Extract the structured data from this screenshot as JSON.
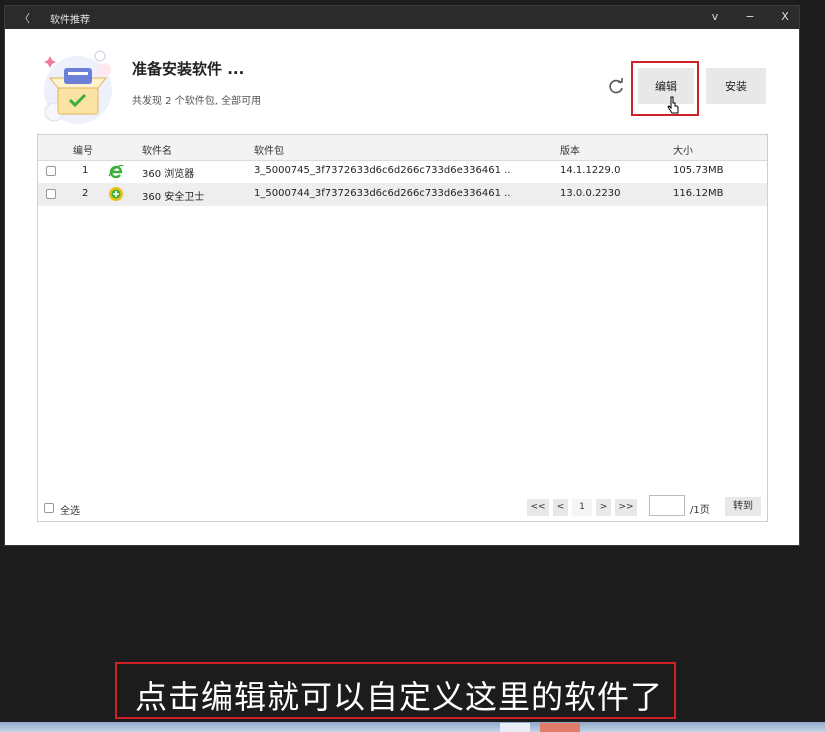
{
  "window": {
    "title": "软件推荐",
    "back_glyph": "〈",
    "controls": {
      "dropdown": "v",
      "minimize": "−",
      "close": "X"
    }
  },
  "header": {
    "title": "准备安装软件 ...",
    "subtitle": "共发现 2 个软件包, 全部可用"
  },
  "toolbar": {
    "edit_label": "编辑",
    "install_label": "安装"
  },
  "table": {
    "columns": [
      "编号",
      "软件名",
      "软件包",
      "版本",
      "大小"
    ],
    "rows": [
      {
        "no": "1",
        "name": "360 浏览器",
        "package": "3_5000745_3f7372633d6c6d266c733d6e336461 ..",
        "version": "14.1.1229.0",
        "size": "105.73MB",
        "icon": "ie-browser-icon",
        "icon_color": "#3cae3a"
      },
      {
        "no": "2",
        "name": "360 安全卫士",
        "package": "1_5000744_3f7372633d6c6d266c733d6e336461 ..",
        "version": "13.0.0.2230",
        "size": "116.12MB",
        "icon": "360-safe-icon",
        "icon_color": "#e8c21a"
      }
    ]
  },
  "footer": {
    "select_all": "全选",
    "first": "<<",
    "prev": "<",
    "page": "1",
    "next": ">",
    "last": ">>",
    "page_input": "",
    "total": "/1页",
    "goto": "转到"
  },
  "caption": "点击编辑就可以自定义这里的软件了",
  "colors": {
    "highlight": "#d0202a",
    "titlebar": "#2b2b2b",
    "button": "#e8e8e8"
  }
}
